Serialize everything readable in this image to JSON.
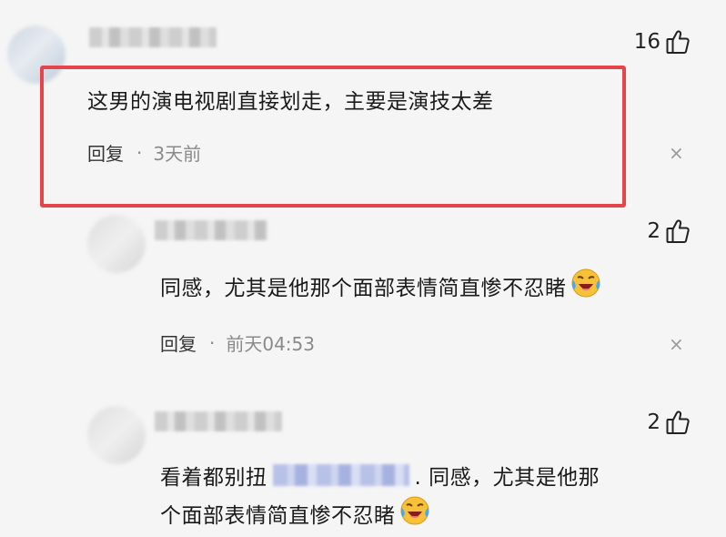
{
  "comments": [
    {
      "likes": "16",
      "text": "这男的演电视剧直接划走，主要是演技太差",
      "reply_label": "回复",
      "separator": "·",
      "time": "3天前",
      "close_glyph": "×"
    },
    {
      "likes": "2",
      "text": "同感，尤其是他那个面部表情简直惨不忍睹",
      "emoji": "crying-laughing-emoji",
      "reply_label": "回复",
      "separator": "·",
      "time": "前天04:53",
      "close_glyph": "×"
    },
    {
      "likes": "2",
      "text_line1_prefix": "看着都别扭",
      "text_line1_suffix": ". 同感，尤其是他那",
      "text_line2": "个面部表情简直惨不忍睹",
      "emoji": "crying-laughing-emoji"
    }
  ],
  "colors": {
    "highlight_border": "#e4444a",
    "background": "#f5f5f5",
    "meta_time": "#8a8a8a"
  },
  "icons": {
    "like": "thumbs-up-icon",
    "close": "close-icon"
  }
}
